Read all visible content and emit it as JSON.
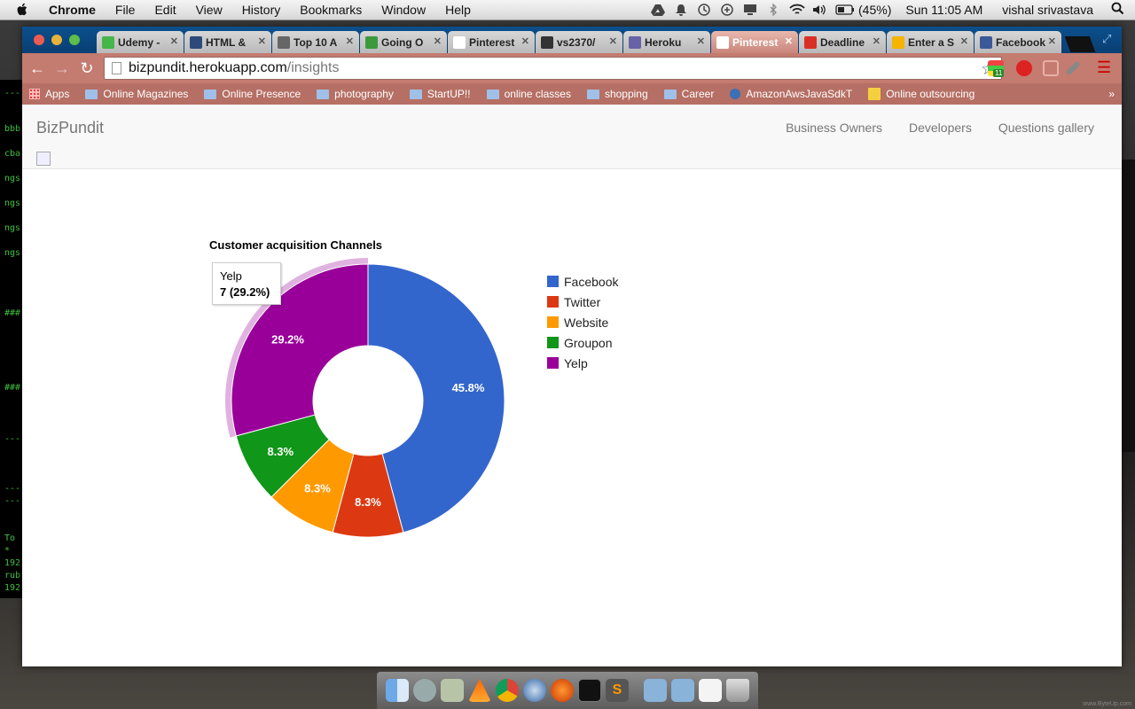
{
  "menubar": {
    "app_name": "Chrome",
    "items": [
      "File",
      "Edit",
      "View",
      "History",
      "Bookmarks",
      "Window",
      "Help"
    ],
    "battery": "(45%)",
    "clock": "Sun 11:05 AM",
    "user": "vishal srivastava"
  },
  "browser": {
    "tabs": [
      {
        "title": "Udemy -",
        "icon": "udemy-icon",
        "color": "#45b649"
      },
      {
        "title": "HTML &",
        "icon": "page-icon",
        "color": "#2d4a7a"
      },
      {
        "title": "Top 10 A",
        "icon": "image-icon",
        "color": "#666666"
      },
      {
        "title": "Going O",
        "icon": "calendar-icon",
        "color": "#3c9a3c"
      },
      {
        "title": "Pinterest",
        "icon": "page-icon",
        "color": "#ffffff"
      },
      {
        "title": "vs2370/",
        "icon": "github-icon",
        "color": "#333333"
      },
      {
        "title": "Heroku",
        "icon": "heroku-icon",
        "color": "#6762a6"
      },
      {
        "title": "Pinterest",
        "icon": "page-icon",
        "color": "#ffffff",
        "active": true
      },
      {
        "title": "Deadline",
        "icon": "gmail-icon",
        "color": "#d93025"
      },
      {
        "title": "Enter a S",
        "icon": "pinwheel-icon",
        "color": "#f4b400"
      },
      {
        "title": "Facebook",
        "icon": "facebook-icon",
        "color": "#3b5998"
      }
    ],
    "url_host": "bizpundit.herokuapp.com",
    "url_path": "/insights",
    "extension_badge": "11",
    "bookmarks": [
      "Apps",
      "Online Magazines",
      "Online Presence",
      "photography",
      "StartUP!!",
      "online classes",
      "shopping",
      "Career",
      "AmazonAwsJavaSdkT",
      "Online outsourcing"
    ]
  },
  "page": {
    "brand": "BizPundit",
    "nav": [
      "Business Owners",
      "Developers",
      "Questions gallery"
    ]
  },
  "chart_data": {
    "type": "pie",
    "donut": true,
    "title": "Customer acquisition Channels",
    "legend_position": "right",
    "categories": [
      "Facebook",
      "Twitter",
      "Website",
      "Groupon",
      "Yelp"
    ],
    "values": [
      11,
      2,
      2,
      2,
      7
    ],
    "percent_labels": [
      "45.8%",
      "8.3%",
      "8.3%",
      "8.3%",
      "29.2%"
    ],
    "colors": [
      "#3366cc",
      "#dc3912",
      "#ff9900",
      "#109618",
      "#990099"
    ],
    "highlighted": "Yelp",
    "tooltip": {
      "label": "Yelp",
      "value": "7 (29.2%)"
    }
  }
}
